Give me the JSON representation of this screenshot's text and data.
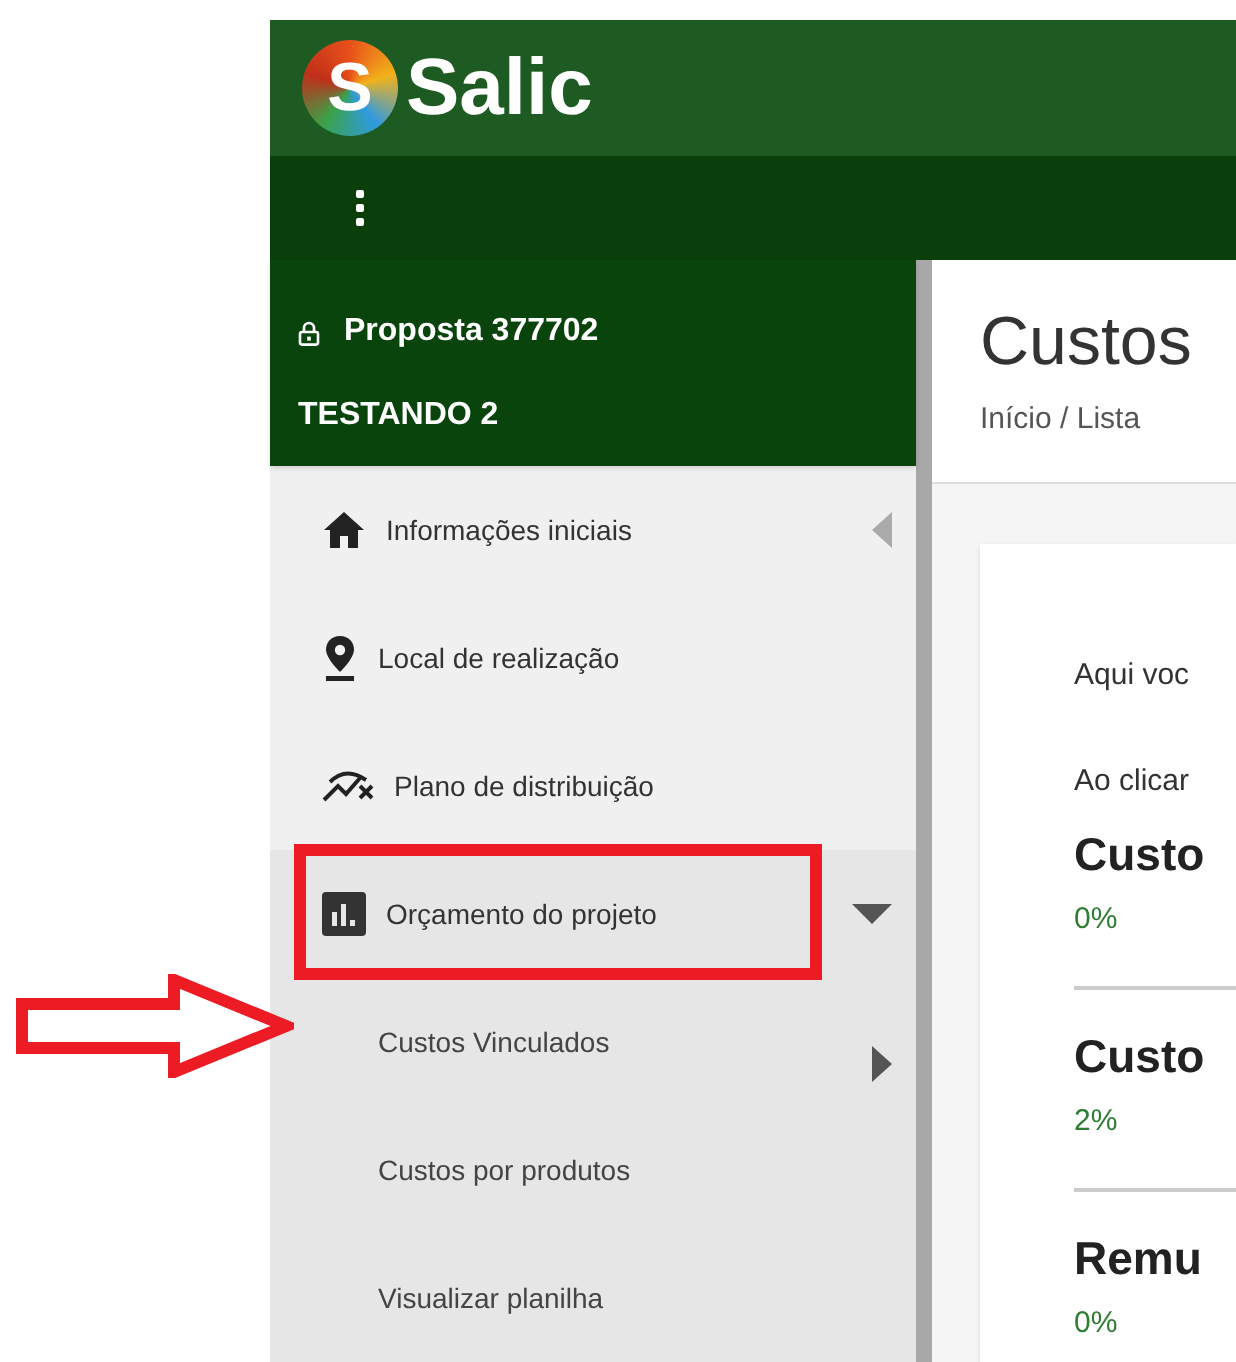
{
  "header": {
    "logo_mark": "S",
    "logo_text": "Salic"
  },
  "proposal": {
    "title": "Proposta 377702",
    "subtitle": "TESTANDO 2"
  },
  "nav": [
    {
      "kind": "home",
      "label": "Informações iniciais",
      "expanded": false,
      "highlighted": false
    },
    {
      "kind": "pin",
      "label": "Local de realização",
      "expanded": false,
      "highlighted": false
    },
    {
      "kind": "route",
      "label": "Plano de distribuição",
      "expanded": false,
      "highlighted": false
    },
    {
      "kind": "chart",
      "label": "Orçamento do projeto",
      "expanded": true,
      "highlighted": true,
      "children": [
        {
          "label": "Custos Vinculados",
          "has_submenu": true,
          "pointed": true
        },
        {
          "label": "Custos por produtos",
          "has_submenu": false,
          "pointed": false
        },
        {
          "label": "Visualizar planilha",
          "has_submenu": false,
          "pointed": false
        }
      ]
    }
  ],
  "page": {
    "title": "Custos",
    "breadcrumb": "Início / Lista"
  },
  "card": {
    "paragraphs": [
      "Aqui voc",
      "Ao clicar"
    ],
    "sections": [
      {
        "title": "Custo",
        "percent": "0%"
      },
      {
        "title": "Custo",
        "percent": "2%"
      },
      {
        "title": "Remu",
        "percent": "0%"
      }
    ]
  }
}
